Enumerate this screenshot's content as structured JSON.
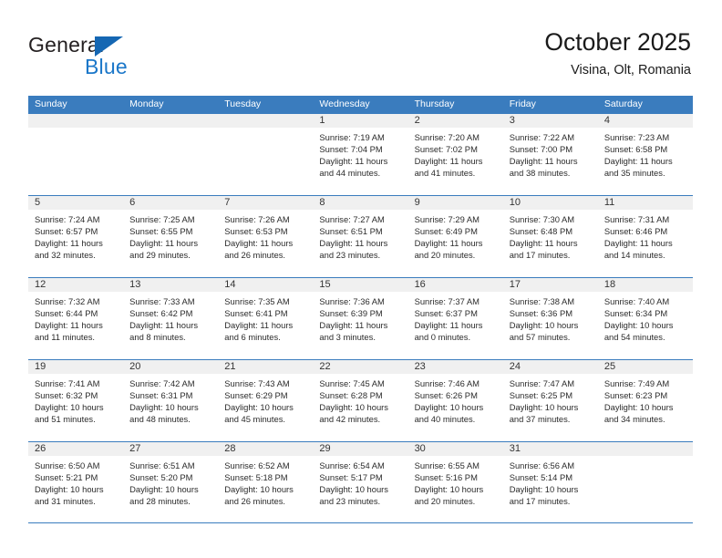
{
  "brand": {
    "name_part1": "General",
    "name_part2": "Blue",
    "color_dark": "#231f20",
    "color_blue": "#1b77c9"
  },
  "header": {
    "title": "October 2025",
    "subtitle": "Visina, Olt, Romania"
  },
  "theme": {
    "header_row_bg": "#3a7cbe",
    "day_band_bg": "#f0f0f0",
    "grid_line": "#3a7cbe"
  },
  "weekdays": [
    "Sunday",
    "Monday",
    "Tuesday",
    "Wednesday",
    "Thursday",
    "Friday",
    "Saturday"
  ],
  "weeks": [
    [
      {
        "day": "",
        "sunrise": "",
        "sunset": "",
        "daylight1": "",
        "daylight2": ""
      },
      {
        "day": "",
        "sunrise": "",
        "sunset": "",
        "daylight1": "",
        "daylight2": ""
      },
      {
        "day": "",
        "sunrise": "",
        "sunset": "",
        "daylight1": "",
        "daylight2": ""
      },
      {
        "day": "1",
        "sunrise": "Sunrise: 7:19 AM",
        "sunset": "Sunset: 7:04 PM",
        "daylight1": "Daylight: 11 hours",
        "daylight2": "and 44 minutes."
      },
      {
        "day": "2",
        "sunrise": "Sunrise: 7:20 AM",
        "sunset": "Sunset: 7:02 PM",
        "daylight1": "Daylight: 11 hours",
        "daylight2": "and 41 minutes."
      },
      {
        "day": "3",
        "sunrise": "Sunrise: 7:22 AM",
        "sunset": "Sunset: 7:00 PM",
        "daylight1": "Daylight: 11 hours",
        "daylight2": "and 38 minutes."
      },
      {
        "day": "4",
        "sunrise": "Sunrise: 7:23 AM",
        "sunset": "Sunset: 6:58 PM",
        "daylight1": "Daylight: 11 hours",
        "daylight2": "and 35 minutes."
      }
    ],
    [
      {
        "day": "5",
        "sunrise": "Sunrise: 7:24 AM",
        "sunset": "Sunset: 6:57 PM",
        "daylight1": "Daylight: 11 hours",
        "daylight2": "and 32 minutes."
      },
      {
        "day": "6",
        "sunrise": "Sunrise: 7:25 AM",
        "sunset": "Sunset: 6:55 PM",
        "daylight1": "Daylight: 11 hours",
        "daylight2": "and 29 minutes."
      },
      {
        "day": "7",
        "sunrise": "Sunrise: 7:26 AM",
        "sunset": "Sunset: 6:53 PM",
        "daylight1": "Daylight: 11 hours",
        "daylight2": "and 26 minutes."
      },
      {
        "day": "8",
        "sunrise": "Sunrise: 7:27 AM",
        "sunset": "Sunset: 6:51 PM",
        "daylight1": "Daylight: 11 hours",
        "daylight2": "and 23 minutes."
      },
      {
        "day": "9",
        "sunrise": "Sunrise: 7:29 AM",
        "sunset": "Sunset: 6:49 PM",
        "daylight1": "Daylight: 11 hours",
        "daylight2": "and 20 minutes."
      },
      {
        "day": "10",
        "sunrise": "Sunrise: 7:30 AM",
        "sunset": "Sunset: 6:48 PM",
        "daylight1": "Daylight: 11 hours",
        "daylight2": "and 17 minutes."
      },
      {
        "day": "11",
        "sunrise": "Sunrise: 7:31 AM",
        "sunset": "Sunset: 6:46 PM",
        "daylight1": "Daylight: 11 hours",
        "daylight2": "and 14 minutes."
      }
    ],
    [
      {
        "day": "12",
        "sunrise": "Sunrise: 7:32 AM",
        "sunset": "Sunset: 6:44 PM",
        "daylight1": "Daylight: 11 hours",
        "daylight2": "and 11 minutes."
      },
      {
        "day": "13",
        "sunrise": "Sunrise: 7:33 AM",
        "sunset": "Sunset: 6:42 PM",
        "daylight1": "Daylight: 11 hours",
        "daylight2": "and 8 minutes."
      },
      {
        "day": "14",
        "sunrise": "Sunrise: 7:35 AM",
        "sunset": "Sunset: 6:41 PM",
        "daylight1": "Daylight: 11 hours",
        "daylight2": "and 6 minutes."
      },
      {
        "day": "15",
        "sunrise": "Sunrise: 7:36 AM",
        "sunset": "Sunset: 6:39 PM",
        "daylight1": "Daylight: 11 hours",
        "daylight2": "and 3 minutes."
      },
      {
        "day": "16",
        "sunrise": "Sunrise: 7:37 AM",
        "sunset": "Sunset: 6:37 PM",
        "daylight1": "Daylight: 11 hours",
        "daylight2": "and 0 minutes."
      },
      {
        "day": "17",
        "sunrise": "Sunrise: 7:38 AM",
        "sunset": "Sunset: 6:36 PM",
        "daylight1": "Daylight: 10 hours",
        "daylight2": "and 57 minutes."
      },
      {
        "day": "18",
        "sunrise": "Sunrise: 7:40 AM",
        "sunset": "Sunset: 6:34 PM",
        "daylight1": "Daylight: 10 hours",
        "daylight2": "and 54 minutes."
      }
    ],
    [
      {
        "day": "19",
        "sunrise": "Sunrise: 7:41 AM",
        "sunset": "Sunset: 6:32 PM",
        "daylight1": "Daylight: 10 hours",
        "daylight2": "and 51 minutes."
      },
      {
        "day": "20",
        "sunrise": "Sunrise: 7:42 AM",
        "sunset": "Sunset: 6:31 PM",
        "daylight1": "Daylight: 10 hours",
        "daylight2": "and 48 minutes."
      },
      {
        "day": "21",
        "sunrise": "Sunrise: 7:43 AM",
        "sunset": "Sunset: 6:29 PM",
        "daylight1": "Daylight: 10 hours",
        "daylight2": "and 45 minutes."
      },
      {
        "day": "22",
        "sunrise": "Sunrise: 7:45 AM",
        "sunset": "Sunset: 6:28 PM",
        "daylight1": "Daylight: 10 hours",
        "daylight2": "and 42 minutes."
      },
      {
        "day": "23",
        "sunrise": "Sunrise: 7:46 AM",
        "sunset": "Sunset: 6:26 PM",
        "daylight1": "Daylight: 10 hours",
        "daylight2": "and 40 minutes."
      },
      {
        "day": "24",
        "sunrise": "Sunrise: 7:47 AM",
        "sunset": "Sunset: 6:25 PM",
        "daylight1": "Daylight: 10 hours",
        "daylight2": "and 37 minutes."
      },
      {
        "day": "25",
        "sunrise": "Sunrise: 7:49 AM",
        "sunset": "Sunset: 6:23 PM",
        "daylight1": "Daylight: 10 hours",
        "daylight2": "and 34 minutes."
      }
    ],
    [
      {
        "day": "26",
        "sunrise": "Sunrise: 6:50 AM",
        "sunset": "Sunset: 5:21 PM",
        "daylight1": "Daylight: 10 hours",
        "daylight2": "and 31 minutes."
      },
      {
        "day": "27",
        "sunrise": "Sunrise: 6:51 AM",
        "sunset": "Sunset: 5:20 PM",
        "daylight1": "Daylight: 10 hours",
        "daylight2": "and 28 minutes."
      },
      {
        "day": "28",
        "sunrise": "Sunrise: 6:52 AM",
        "sunset": "Sunset: 5:18 PM",
        "daylight1": "Daylight: 10 hours",
        "daylight2": "and 26 minutes."
      },
      {
        "day": "29",
        "sunrise": "Sunrise: 6:54 AM",
        "sunset": "Sunset: 5:17 PM",
        "daylight1": "Daylight: 10 hours",
        "daylight2": "and 23 minutes."
      },
      {
        "day": "30",
        "sunrise": "Sunrise: 6:55 AM",
        "sunset": "Sunset: 5:16 PM",
        "daylight1": "Daylight: 10 hours",
        "daylight2": "and 20 minutes."
      },
      {
        "day": "31",
        "sunrise": "Sunrise: 6:56 AM",
        "sunset": "Sunset: 5:14 PM",
        "daylight1": "Daylight: 10 hours",
        "daylight2": "and 17 minutes."
      },
      {
        "day": "",
        "sunrise": "",
        "sunset": "",
        "daylight1": "",
        "daylight2": ""
      }
    ]
  ]
}
